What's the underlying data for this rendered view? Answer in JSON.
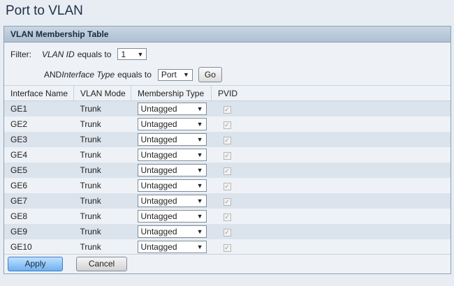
{
  "page_title": "Port to VLAN",
  "panel": {
    "title": "VLAN Membership Table",
    "filter": {
      "label": "Filter:",
      "vlan_id_label": "VLAN ID",
      "equals_to": "equals to",
      "vlan_id_value": "1",
      "and_label": "AND",
      "interface_type_label": "Interface Type",
      "interface_type_value": "Port",
      "go_label": "Go"
    },
    "columns": [
      "Interface Name",
      "VLAN Mode",
      "Membership Type",
      "PVID"
    ],
    "rows": [
      {
        "interface": "GE1",
        "mode": "Trunk",
        "membership": "Untagged",
        "pvid": true
      },
      {
        "interface": "GE2",
        "mode": "Trunk",
        "membership": "Untagged",
        "pvid": true
      },
      {
        "interface": "GE3",
        "mode": "Trunk",
        "membership": "Untagged",
        "pvid": true
      },
      {
        "interface": "GE4",
        "mode": "Trunk",
        "membership": "Untagged",
        "pvid": true
      },
      {
        "interface": "GE5",
        "mode": "Trunk",
        "membership": "Untagged",
        "pvid": true
      },
      {
        "interface": "GE6",
        "mode": "Trunk",
        "membership": "Untagged",
        "pvid": true
      },
      {
        "interface": "GE7",
        "mode": "Trunk",
        "membership": "Untagged",
        "pvid": true
      },
      {
        "interface": "GE8",
        "mode": "Trunk",
        "membership": "Untagged",
        "pvid": true
      },
      {
        "interface": "GE9",
        "mode": "Trunk",
        "membership": "Untagged",
        "pvid": true
      },
      {
        "interface": "GE10",
        "mode": "Trunk",
        "membership": "Untagged",
        "pvid": true
      }
    ],
    "buttons": {
      "apply": "Apply",
      "cancel": "Cancel"
    }
  }
}
